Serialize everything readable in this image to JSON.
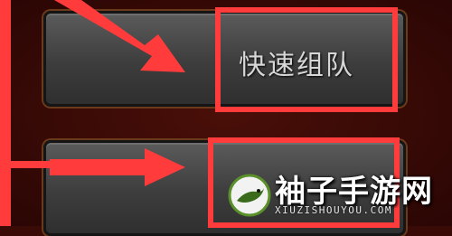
{
  "buttons": [
    {
      "label": "快速组队"
    },
    {
      "label": "...",
      "obscured": true
    }
  ],
  "colors": {
    "highlight": "#ff3b3b",
    "button_face": "#4a4a4a",
    "background": "#3a0a06"
  },
  "watermark": {
    "brand": "袖子手游网",
    "domain": "XIUZISHOUYOU.COM",
    "icon": "bird-logo-icon"
  }
}
